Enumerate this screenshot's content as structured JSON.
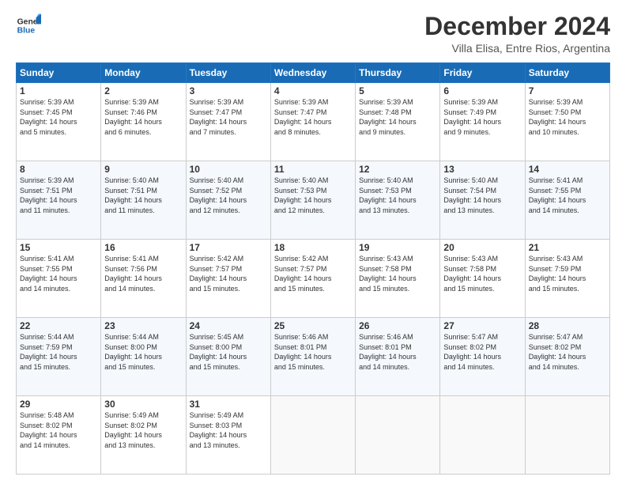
{
  "header": {
    "logo_line1": "General",
    "logo_line2": "Blue",
    "month_title": "December 2024",
    "location": "Villa Elisa, Entre Rios, Argentina"
  },
  "days_of_week": [
    "Sunday",
    "Monday",
    "Tuesday",
    "Wednesday",
    "Thursday",
    "Friday",
    "Saturday"
  ],
  "weeks": [
    [
      {
        "day": "1",
        "rise": "5:39 AM",
        "set": "7:45 PM",
        "daylight": "14 hours and 5 minutes."
      },
      {
        "day": "2",
        "rise": "5:39 AM",
        "set": "7:46 PM",
        "daylight": "14 hours and 6 minutes."
      },
      {
        "day": "3",
        "rise": "5:39 AM",
        "set": "7:47 PM",
        "daylight": "14 hours and 7 minutes."
      },
      {
        "day": "4",
        "rise": "5:39 AM",
        "set": "7:47 PM",
        "daylight": "14 hours and 8 minutes."
      },
      {
        "day": "5",
        "rise": "5:39 AM",
        "set": "7:48 PM",
        "daylight": "14 hours and 9 minutes."
      },
      {
        "day": "6",
        "rise": "5:39 AM",
        "set": "7:49 PM",
        "daylight": "14 hours and 9 minutes."
      },
      {
        "day": "7",
        "rise": "5:39 AM",
        "set": "7:50 PM",
        "daylight": "14 hours and 10 minutes."
      }
    ],
    [
      {
        "day": "8",
        "rise": "5:39 AM",
        "set": "7:51 PM",
        "daylight": "14 hours and 11 minutes."
      },
      {
        "day": "9",
        "rise": "5:40 AM",
        "set": "7:51 PM",
        "daylight": "14 hours and 11 minutes."
      },
      {
        "day": "10",
        "rise": "5:40 AM",
        "set": "7:52 PM",
        "daylight": "14 hours and 12 minutes."
      },
      {
        "day": "11",
        "rise": "5:40 AM",
        "set": "7:53 PM",
        "daylight": "14 hours and 12 minutes."
      },
      {
        "day": "12",
        "rise": "5:40 AM",
        "set": "7:53 PM",
        "daylight": "14 hours and 13 minutes."
      },
      {
        "day": "13",
        "rise": "5:40 AM",
        "set": "7:54 PM",
        "daylight": "14 hours and 13 minutes."
      },
      {
        "day": "14",
        "rise": "5:41 AM",
        "set": "7:55 PM",
        "daylight": "14 hours and 14 minutes."
      }
    ],
    [
      {
        "day": "15",
        "rise": "5:41 AM",
        "set": "7:55 PM",
        "daylight": "14 hours and 14 minutes."
      },
      {
        "day": "16",
        "rise": "5:41 AM",
        "set": "7:56 PM",
        "daylight": "14 hours and 14 minutes."
      },
      {
        "day": "17",
        "rise": "5:42 AM",
        "set": "7:57 PM",
        "daylight": "14 hours and 15 minutes."
      },
      {
        "day": "18",
        "rise": "5:42 AM",
        "set": "7:57 PM",
        "daylight": "14 hours and 15 minutes."
      },
      {
        "day": "19",
        "rise": "5:43 AM",
        "set": "7:58 PM",
        "daylight": "14 hours and 15 minutes."
      },
      {
        "day": "20",
        "rise": "5:43 AM",
        "set": "7:58 PM",
        "daylight": "14 hours and 15 minutes."
      },
      {
        "day": "21",
        "rise": "5:43 AM",
        "set": "7:59 PM",
        "daylight": "14 hours and 15 minutes."
      }
    ],
    [
      {
        "day": "22",
        "rise": "5:44 AM",
        "set": "7:59 PM",
        "daylight": "14 hours and 15 minutes."
      },
      {
        "day": "23",
        "rise": "5:44 AM",
        "set": "8:00 PM",
        "daylight": "14 hours and 15 minutes."
      },
      {
        "day": "24",
        "rise": "5:45 AM",
        "set": "8:00 PM",
        "daylight": "14 hours and 15 minutes."
      },
      {
        "day": "25",
        "rise": "5:46 AM",
        "set": "8:01 PM",
        "daylight": "14 hours and 15 minutes."
      },
      {
        "day": "26",
        "rise": "5:46 AM",
        "set": "8:01 PM",
        "daylight": "14 hours and 14 minutes."
      },
      {
        "day": "27",
        "rise": "5:47 AM",
        "set": "8:02 PM",
        "daylight": "14 hours and 14 minutes."
      },
      {
        "day": "28",
        "rise": "5:47 AM",
        "set": "8:02 PM",
        "daylight": "14 hours and 14 minutes."
      }
    ],
    [
      {
        "day": "29",
        "rise": "5:48 AM",
        "set": "8:02 PM",
        "daylight": "14 hours and 14 minutes."
      },
      {
        "day": "30",
        "rise": "5:49 AM",
        "set": "8:02 PM",
        "daylight": "14 hours and 13 minutes."
      },
      {
        "day": "31",
        "rise": "5:49 AM",
        "set": "8:03 PM",
        "daylight": "14 hours and 13 minutes."
      },
      null,
      null,
      null,
      null
    ]
  ],
  "labels": {
    "sunrise": "Sunrise:",
    "sunset": "Sunset:",
    "daylight": "Daylight:"
  }
}
